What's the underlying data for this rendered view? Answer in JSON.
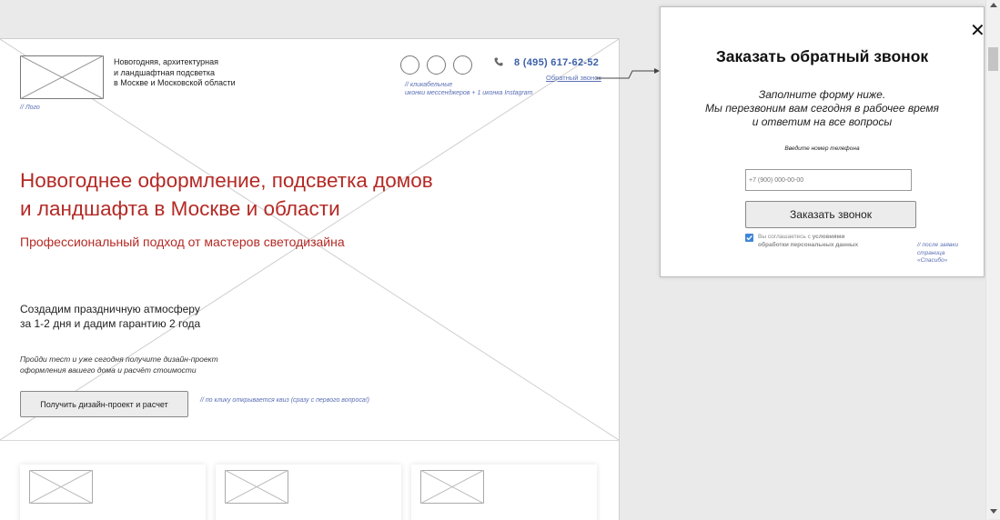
{
  "header": {
    "tagline": "Новогодняя, архитектурная\nи ландшафтная подсветка\nв Москве и Московской области",
    "logo_note": "// Лого",
    "messenger_note": "// кликабельные\nиконки мессенджеров + 1 иконка Instagram",
    "phone": "8 (495) 617-62-52",
    "callback_link": "Обратный звонок"
  },
  "hero": {
    "title": "Новогоднее оформление, подсветка домов\nи ландшафта в Москве и области",
    "subtitle": "Профессиональный подход от мастеров светодизайна",
    "atmosphere": "Создадим праздничную атмосферу\nза 1-2 дня и дадим гарантию 2 года",
    "quiz_text": "Пройди тест и уже сегодня получите дизайн-проект\nоформления вашего дома и расчёт стоимости",
    "cta_label": "Получить дизайн-проект и расчет",
    "cta_note": "// по клику открывается квиз (сразу с первого вопроса!)"
  },
  "modal": {
    "title": "Заказать обратный звонок",
    "description": "Заполните форму ниже.\nМы перезвоним вам сегодня в рабочее время\nи ответим на все вопросы",
    "phone_label": "Введите номер телефона",
    "phone_placeholder": "+7 (900) 000-00-00",
    "submit_label": "Заказать звонок",
    "consent_prefix": "Вы соглашаетесь с",
    "consent_bold": "условиями\nобработки персональных данных",
    "thanks_note": "// после заявки страница\n«Спасибо»",
    "close_glyph": "✕"
  },
  "icons": {
    "messengers": [
      "messenger-icon",
      "messenger-icon",
      "instagram-icon"
    ],
    "phone": "phone-icon",
    "close": "close-icon"
  },
  "colors": {
    "accent_red": "#b42a25",
    "link_blue": "#3b5fa8",
    "note_blue": "#5a6fb5",
    "checkbox_blue": "#3f86d6"
  }
}
